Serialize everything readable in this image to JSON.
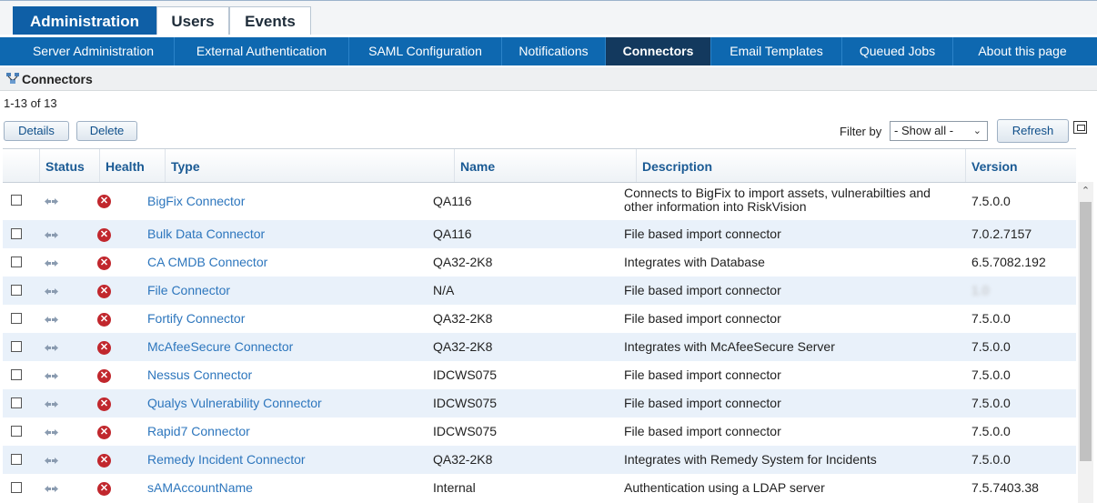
{
  "top_tabs": [
    "Administration",
    "Users",
    "Events"
  ],
  "subnav": [
    "Server Administration",
    "External Authentication",
    "SAML Configuration",
    "Notifications",
    "Connectors",
    "Email Templates",
    "Queued Jobs",
    "About this page"
  ],
  "section_title": "Connectors",
  "count": "1-13 of 13",
  "buttons": {
    "details": "Details",
    "delete": "Delete",
    "refresh": "Refresh"
  },
  "filter": {
    "label": "Filter by",
    "selected": "- Show all -"
  },
  "columns": {
    "status": "Status",
    "health": "Health",
    "type": "Type",
    "name": "Name",
    "description": "Description",
    "version": "Version"
  },
  "rows": [
    {
      "type": "BigFix Connector",
      "name": "QA116",
      "description": "Connects to BigFix to import assets, vulnerabilties and other information into RiskVision",
      "version": "7.5.0.0"
    },
    {
      "type": "Bulk Data Connector",
      "name": "QA116",
      "description": "File based import connector",
      "version": "7.0.2.7157"
    },
    {
      "type": "CA CMDB Connector",
      "name": "QA32-2K8",
      "description": "Integrates with Database",
      "version": "6.5.7082.192"
    },
    {
      "type": "File Connector",
      "name": "N/A",
      "description": "File based import connector",
      "version": "1.0"
    },
    {
      "type": "Fortify Connector",
      "name": "QA32-2K8",
      "description": "File based import connector",
      "version": "7.5.0.0"
    },
    {
      "type": "McAfeeSecure Connector",
      "name": "QA32-2K8",
      "description": "Integrates with McAfeeSecure Server",
      "version": "7.5.0.0"
    },
    {
      "type": "Nessus Connector",
      "name": "IDCWS075",
      "description": "File based import connector",
      "version": "7.5.0.0"
    },
    {
      "type": "Qualys Vulnerability Connector",
      "name": "IDCWS075",
      "description": "File based import connector",
      "version": "7.5.0.0"
    },
    {
      "type": "Rapid7 Connector",
      "name": "IDCWS075",
      "description": "File based import connector",
      "version": "7.5.0.0"
    },
    {
      "type": "Remedy Incident Connector",
      "name": "QA32-2K8",
      "description": "Integrates with Remedy System for Incidents",
      "version": "7.5.0.0"
    },
    {
      "type": "sAMAccountName",
      "name": "Internal",
      "description": "Authentication using a LDAP server",
      "version": "7.5.7403.38"
    }
  ],
  "icons": {
    "status": "connector-arrows-icon",
    "health": "error-x-icon",
    "section": "connectors-icon"
  },
  "colors": {
    "nav_blue": "#0e68b0",
    "active_subnav": "#13395e",
    "link": "#2d76bd",
    "error": "#c1272d"
  }
}
